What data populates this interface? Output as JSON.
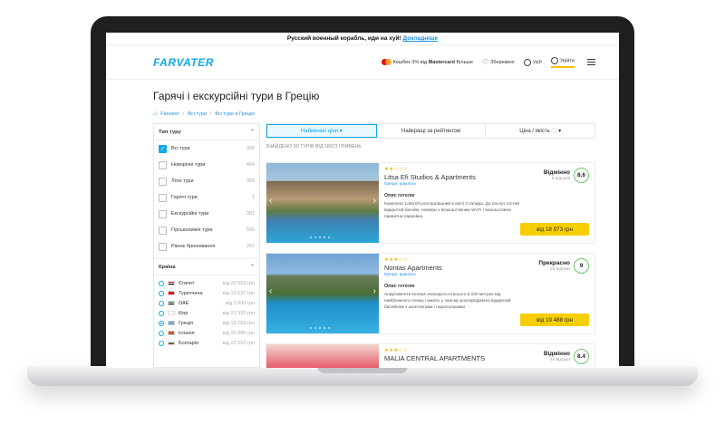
{
  "banner": {
    "text": "Русский военный корабль, иди на хуй!",
    "link": "Докладніше"
  },
  "header": {
    "logo": "FARVATER",
    "cashback_pre": "Кешбек 3% від",
    "cashback_brand": "Mastercard",
    "cashback_post": "Більше",
    "favorites": "Збережені",
    "language": "УКР",
    "login": "Увійти"
  },
  "page": {
    "title": "Гарячі і екскурсійні тури в Грецію",
    "breadcrumbs": [
      "Farvater",
      "Всі тури",
      "Всі тури в Грецію"
    ]
  },
  "sidebar": {
    "tour_type_title": "Тип туру",
    "tour_types": [
      {
        "label": "Всі тури",
        "count": "368",
        "checked": true
      },
      {
        "label": "Новорічні тури",
        "count": "404",
        "checked": false
      },
      {
        "label": "Літні тури",
        "count": "389",
        "checked": false
      },
      {
        "label": "Гарячі тури",
        "count": "1",
        "checked": false
      },
      {
        "label": "Екскурсійні тури",
        "count": "381",
        "checked": false
      },
      {
        "label": "Гірськолижні тури",
        "count": "509",
        "checked": false
      },
      {
        "label": "Раннє бронювання",
        "count": "261",
        "checked": false
      }
    ],
    "country_title": "Країна",
    "countries": [
      {
        "label": "Єгипет",
        "price": "від 20 553 грн",
        "selected": false,
        "flag": [
          "#ce1126",
          "#ffffff",
          "#000000"
        ]
      },
      {
        "label": "Туреччина",
        "price": "від 13 637 грн",
        "selected": false,
        "flag": [
          "#e30a17",
          "#e30a17",
          "#e30a17"
        ]
      },
      {
        "label": "ОАЕ",
        "price": "від 0 000 грн",
        "selected": false,
        "flag": [
          "#00732f",
          "#ffffff",
          "#000000"
        ]
      },
      {
        "label": "Кіпр",
        "price": "від 21 515 грн",
        "selected": false,
        "flag": [
          "#ffffff",
          "#ffffff",
          "#ffffff"
        ]
      },
      {
        "label": "Греція",
        "price": "від 19 283 грн",
        "selected": true,
        "flag": [
          "#0d5eaf",
          "#ffffff",
          "#0d5eaf"
        ]
      },
      {
        "label": "Іспанія",
        "price": "від 25 880 грн",
        "selected": false,
        "flag": [
          "#aa151b",
          "#f1bf00",
          "#aa151b"
        ]
      },
      {
        "label": "Болгарія",
        "price": "від 22 552 грн",
        "selected": false,
        "flag": [
          "#ffffff",
          "#00966e",
          "#d62612"
        ]
      }
    ]
  },
  "sort": {
    "cheapest": "Найменші ціни",
    "rating": "Найкращі за рейтингом",
    "value": "Ціна / якість"
  },
  "found": "ЗНАЙДЕНО 50 ТУРІВ ВІД 18973 ГРИВЕНЬ",
  "hotels": [
    {
      "stars": "★★☆☆☆",
      "name": "Litsa Efi Studios & Apartments",
      "location": "Греція, Іракліон",
      "desc_title": "Опис готелю",
      "desc": "Комплекс Litsa Efi розташований в місті Сталида. До послуг гостей відкритий басейн, номери з безкоштовним Wi-Fi і безкоштовна приватна парковка.",
      "rating_word": "Відмінно",
      "reviews": "6 відгуків",
      "score": "8.6",
      "price": "від 18 973 грн"
    },
    {
      "stars": "★★★☆☆",
      "name": "Nontas Apartments",
      "location": "Греція, Іракліон",
      "desc_title": "Опис готелю",
      "desc": "Апартаменти Nontas знаходяться всього в 100 метрах від найближчого пляжу і мають у своєму розпорядженні відкритий басейном з шезлонгами і парасольками",
      "rating_word": "Прекрасно",
      "reviews": "33 відгуки",
      "score": "9",
      "price": "від 19 488 грн"
    },
    {
      "stars": "★★★☆☆",
      "name": "MALIA CENTRAL APARTMENTS",
      "location": "",
      "desc_title": "",
      "desc": "",
      "rating_word": "Відмінно",
      "reviews": "44 відгуки",
      "score": "8.4",
      "price": ""
    }
  ]
}
